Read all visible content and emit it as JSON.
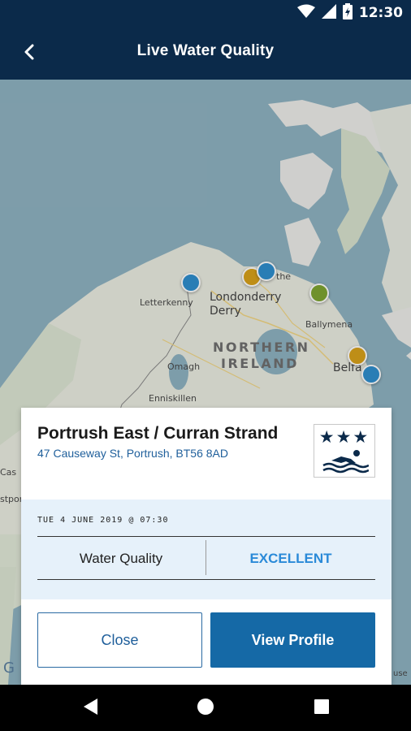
{
  "status_bar": {
    "time": "12:30"
  },
  "app_bar": {
    "title": "Live Water Quality"
  },
  "map": {
    "labels": {
      "letterkenny": "Letterkenny",
      "londonderry": "Londonderry",
      "derry": "Derry",
      "northern": "NORTHERN",
      "ireland": "IRELAND",
      "ballymena": "Ballymena",
      "omagh": "Omagh",
      "enniskillen": "Enniskillen",
      "belfast": "Belfa",
      "partial_the": "the",
      "partial_cas": "Cas",
      "partial_stpor": "stpor",
      "partial_google": "G",
      "partial_use": "use"
    },
    "pin_colors": {
      "blue": "#2f8fcf",
      "amber": "#d9a21b",
      "green": "#7fa532"
    }
  },
  "card": {
    "name": "Portrush East / Curran Strand",
    "address": "47 Causeway St, Portrush, BT56 8AD",
    "rating_stars": "★★★",
    "reading": {
      "timestamp": "TUE 4 JUNE 2019 @ 07:30",
      "quality_label": "Water Quality",
      "quality_value": "EXCELLENT"
    },
    "close_label": "Close",
    "profile_label": "View Profile"
  }
}
